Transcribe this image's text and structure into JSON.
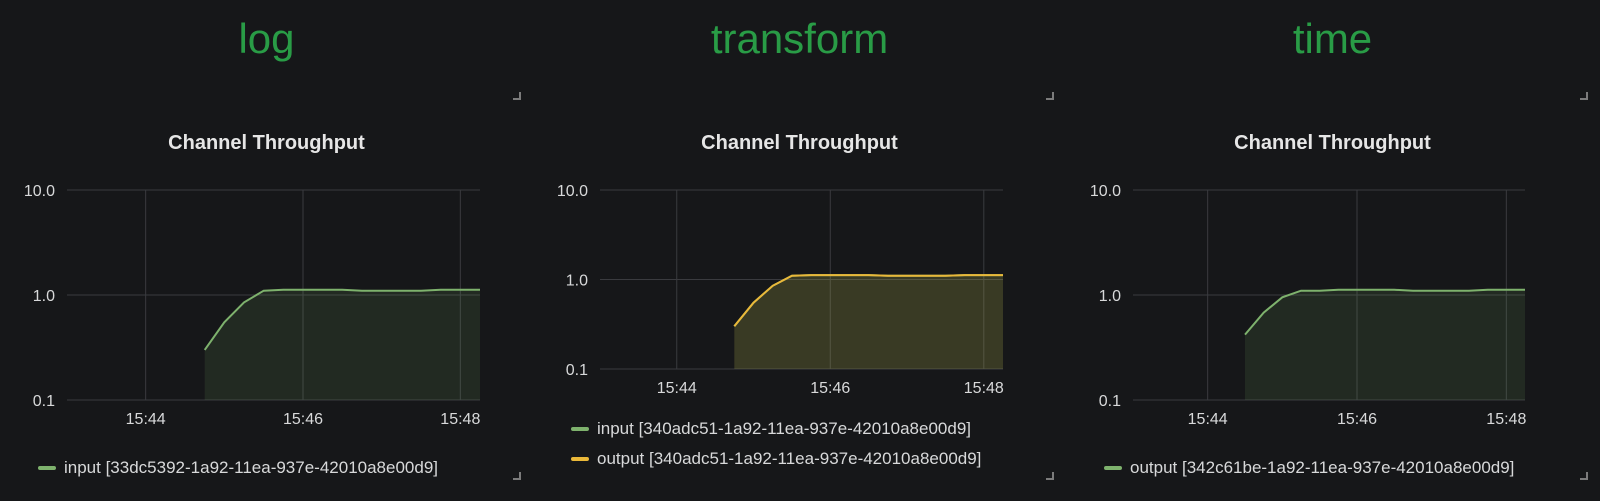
{
  "headings": [
    "log",
    "transform",
    "time"
  ],
  "chart_data": [
    {
      "type": "area",
      "title": "Channel Throughput",
      "yscale": "log",
      "ylim": [
        0.1,
        10
      ],
      "yticks": [
        "10.0",
        "1.0",
        "0.1"
      ],
      "xlim": [
        "15:43:00",
        "15:48:15"
      ],
      "xticks": [
        "15:44",
        "15:46",
        "15:48"
      ],
      "grid": true,
      "legend_position": "bottom-left",
      "series": [
        {
          "name": "input [33dc5392-1a92-11ea-937e-42010a8e00d9]",
          "color": "#7eb26d",
          "x": [
            "15:44:45",
            "15:45:00",
            "15:45:15",
            "15:45:30",
            "15:45:45",
            "15:46:00",
            "15:46:15",
            "15:46:30",
            "15:46:45",
            "15:47:00",
            "15:47:15",
            "15:47:30",
            "15:47:45",
            "15:48:00",
            "15:48:15"
          ],
          "values": [
            0.3,
            0.55,
            0.85,
            1.1,
            1.12,
            1.12,
            1.12,
            1.12,
            1.1,
            1.1,
            1.1,
            1.1,
            1.12,
            1.12,
            1.12
          ]
        }
      ]
    },
    {
      "type": "area",
      "title": "Channel Throughput",
      "yscale": "log",
      "ylim": [
        0.1,
        10
      ],
      "yticks": [
        "10.0",
        "1.0",
        "0.1"
      ],
      "xlim": [
        "15:43:00",
        "15:48:15"
      ],
      "xticks": [
        "15:44",
        "15:46",
        "15:48"
      ],
      "grid": true,
      "legend_position": "bottom-left",
      "series": [
        {
          "name": "input [340adc51-1a92-11ea-937e-42010a8e00d9]",
          "color": "#7eb26d",
          "x": [
            "15:44:45",
            "15:45:00",
            "15:45:15",
            "15:45:30",
            "15:45:45",
            "15:46:00",
            "15:46:15",
            "15:46:30",
            "15:46:45",
            "15:47:00",
            "15:47:15",
            "15:47:30",
            "15:47:45",
            "15:48:00",
            "15:48:15"
          ],
          "values": [
            0.3,
            0.55,
            0.85,
            1.1,
            1.12,
            1.12,
            1.12,
            1.12,
            1.1,
            1.1,
            1.1,
            1.1,
            1.12,
            1.12,
            1.12
          ]
        },
        {
          "name": "output [340adc51-1a92-11ea-937e-42010a8e00d9]",
          "color": "#eab839",
          "x": [
            "15:44:45",
            "15:45:00",
            "15:45:15",
            "15:45:30",
            "15:45:45",
            "15:46:00",
            "15:46:15",
            "15:46:30",
            "15:46:45",
            "15:47:00",
            "15:47:15",
            "15:47:30",
            "15:47:45",
            "15:48:00",
            "15:48:15"
          ],
          "values": [
            0.3,
            0.55,
            0.85,
            1.1,
            1.12,
            1.12,
            1.12,
            1.12,
            1.1,
            1.1,
            1.1,
            1.1,
            1.12,
            1.12,
            1.12
          ]
        }
      ]
    },
    {
      "type": "area",
      "title": "Channel Throughput",
      "yscale": "log",
      "ylim": [
        0.1,
        10
      ],
      "yticks": [
        "10.0",
        "1.0",
        "0.1"
      ],
      "xlim": [
        "15:43:00",
        "15:48:15"
      ],
      "xticks": [
        "15:44",
        "15:46",
        "15:48"
      ],
      "grid": true,
      "legend_position": "bottom-left",
      "series": [
        {
          "name": "output [342c61be-1a92-11ea-937e-42010a8e00d9]",
          "color": "#7eb26d",
          "x": [
            "15:44:30",
            "15:44:45",
            "15:45:00",
            "15:45:15",
            "15:45:30",
            "15:45:45",
            "15:46:00",
            "15:46:15",
            "15:46:30",
            "15:46:45",
            "15:47:00",
            "15:47:15",
            "15:47:30",
            "15:47:45",
            "15:48:00",
            "15:48:15"
          ],
          "values": [
            0.42,
            0.68,
            0.95,
            1.1,
            1.1,
            1.12,
            1.12,
            1.12,
            1.12,
            1.1,
            1.1,
            1.1,
            1.1,
            1.12,
            1.12,
            1.12
          ]
        }
      ]
    }
  ]
}
